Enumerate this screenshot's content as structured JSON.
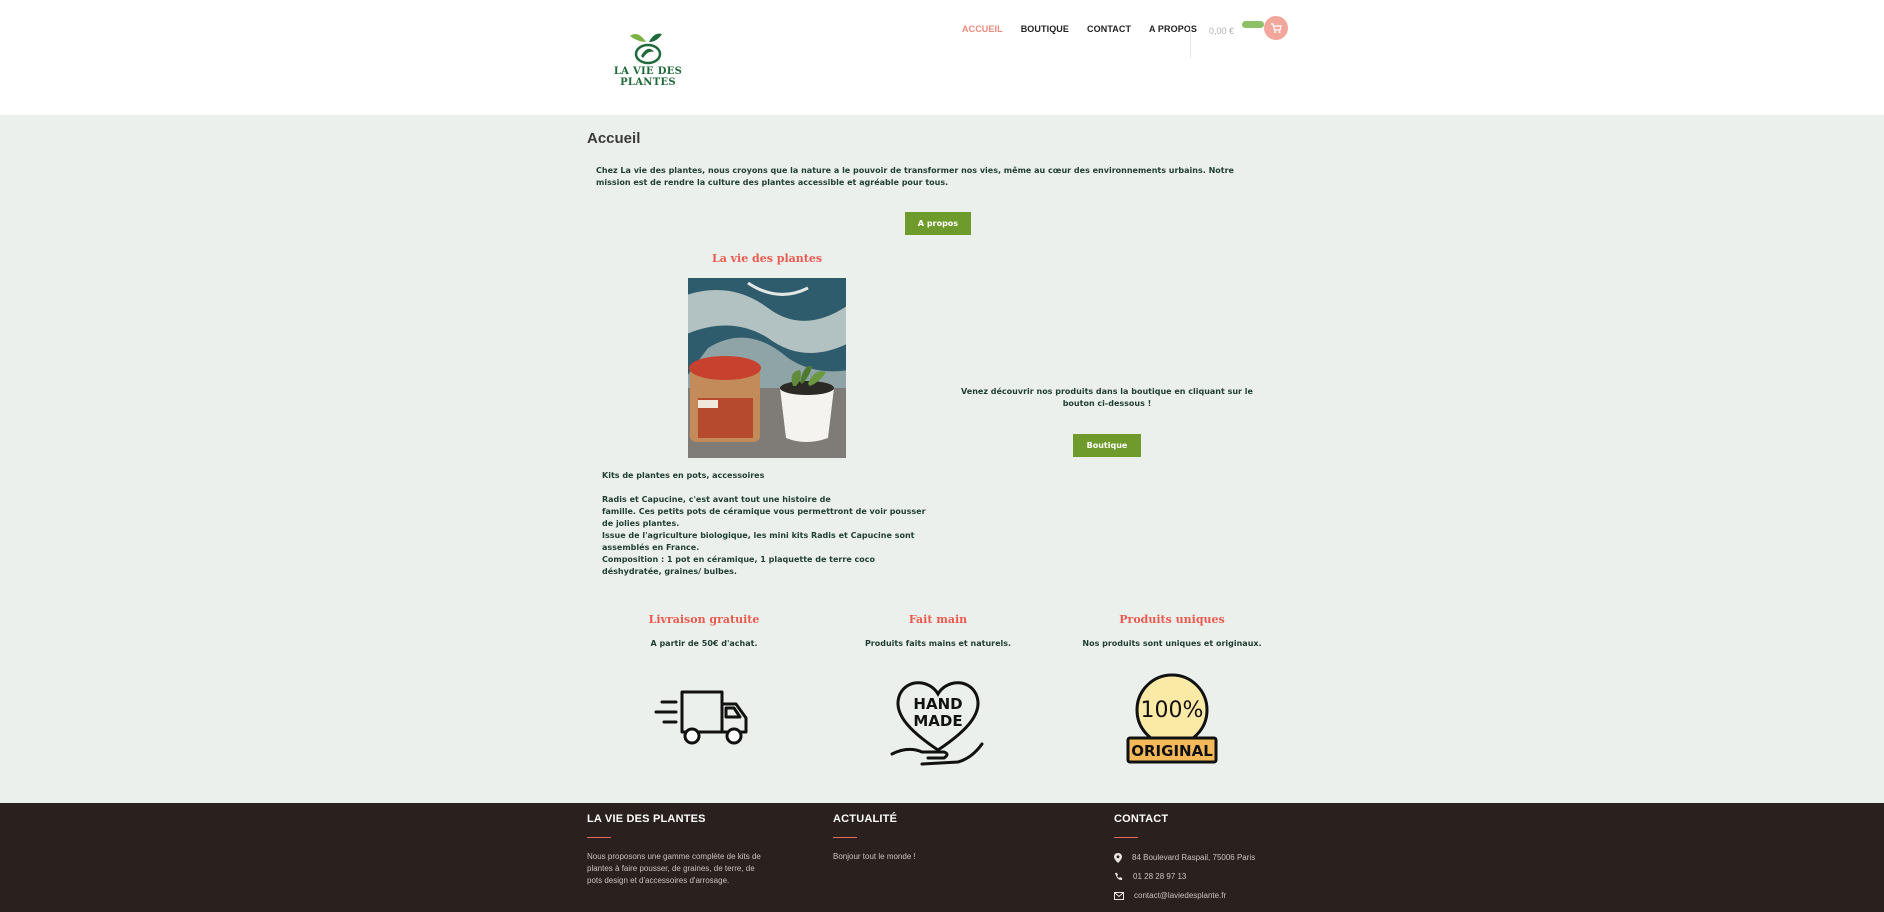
{
  "header": {
    "logo_text_line1": "LA VIE DES",
    "logo_text_line2": "PLANTES",
    "nav": [
      {
        "label": "ACCUEIL"
      },
      {
        "label": "BOUTIQUE"
      },
      {
        "label": "CONTACT"
      },
      {
        "label": "A PROPOS"
      }
    ],
    "cart_total": "0,00 €"
  },
  "main": {
    "page_title": "Accueil",
    "intro": "Chez La vie des plantes, nous croyons que la nature a le pouvoir de transformer nos vies, même au cœur des environnements urbains. Notre mission est de rendre la culture des plantes accessible et agréable pour tous.",
    "apropos_button": "A propos",
    "product_title": "La vie des plantes",
    "product_desc": {
      "line1": "Kits de plantes en pots, accessoires",
      "line2": "Radis et Capucine, c'est avant tout une histoire de",
      "line3": "famille. Ces petits pots de céramique vous permettront de voir pousser de jolies plantes.",
      "line4": "Issue de l'agriculture biologique, les mini kits Radis et Capucine sont assemblés en France.",
      "line5": "Composition : 1 pot en céramique, 1 plaquette de terre coco déshydratée, graines/ bulbes."
    },
    "boutique_text": "Venez découvrir nos produits dans la boutique en cliquant sur le bouton ci-dessous !",
    "boutique_button": "Boutique",
    "features": [
      {
        "title": "Livraison gratuite",
        "text": "A partir de 50€ d'achat.",
        "icon": "truck-icon"
      },
      {
        "title": "Fait main",
        "text": "Produits faits mains et naturels.",
        "icon": "handmade-icon"
      },
      {
        "title": "Produits uniques",
        "text": "Nos produits sont uniques et originaux.",
        "icon": "original-badge-icon"
      }
    ],
    "handmade_line1": "HAND",
    "handmade_line2": "MADE",
    "original_pct": "100%",
    "original_label": "ORIGINAL"
  },
  "footer": {
    "col1_title": "LA VIE DES PLANTES",
    "col1_text": "Nous proposons une gamme complète de kits de plantes à faire pousser, de graines, de terre, de pots design et d'accessoires d'arrosage.",
    "col2_title": "ACTUALITÉ",
    "col2_link": "Bonjour tout le monde !",
    "col3_title": "CONTACT",
    "address": "84 Boulevard Raspail, 75006 Paris",
    "phone": "01 28 28 97 13",
    "email": "contact@laviedesplante.fr"
  },
  "colors": {
    "accent_red": "#ea5a50",
    "button_green": "#6f9b2d",
    "page_bg": "#ecf0ec",
    "footer_bg": "#2a211f"
  }
}
